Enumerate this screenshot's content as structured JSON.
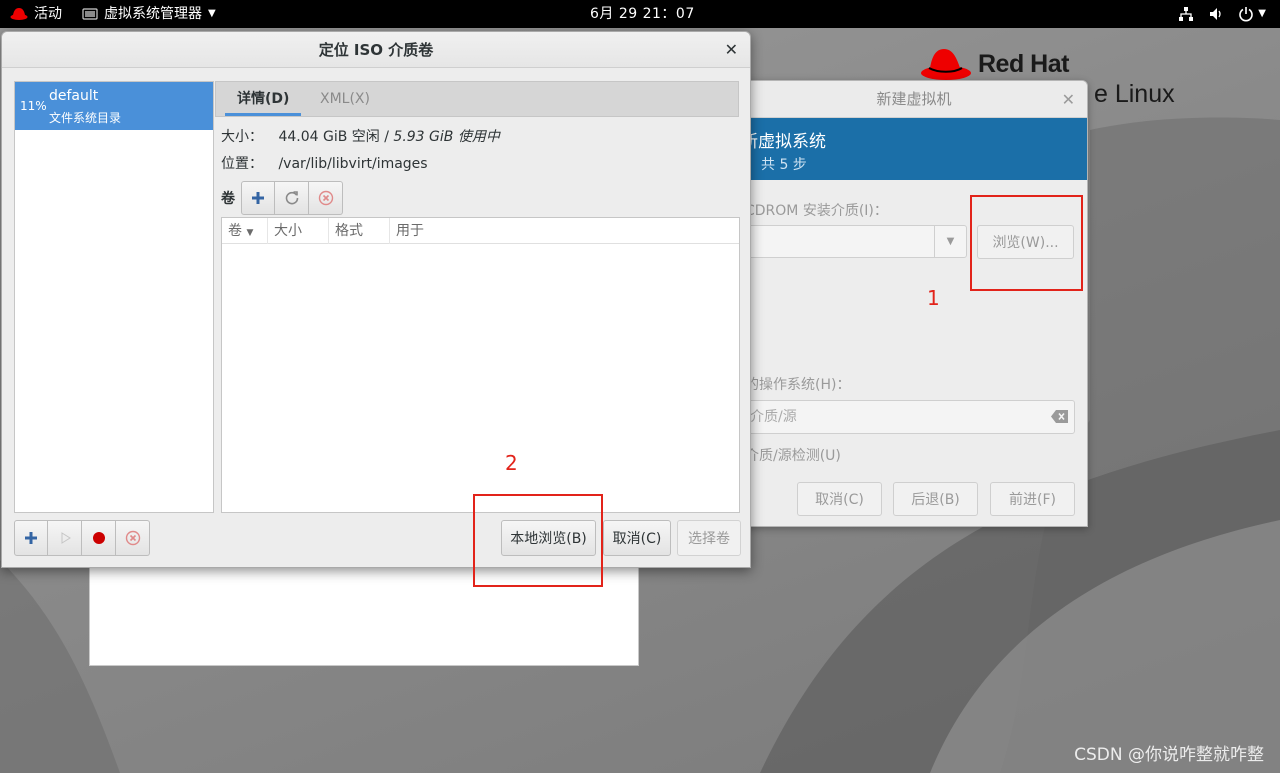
{
  "topbar": {
    "activities": "活动",
    "app_menu": "虚拟系统管理器",
    "clock": "6月 29  21：07",
    "tray_icons": [
      "network-icon",
      "volume-icon",
      "power-icon"
    ]
  },
  "desktop": {
    "brand_name": "Red Hat",
    "brand_sub": "e Linux",
    "watermark": "CSDN @你说咋整就咋整"
  },
  "new_vm_window": {
    "title": "新建虚拟机",
    "banner_title": "新虚拟系统",
    "banner_step": "共 5 步",
    "media_label": "CDROM 安装介质(I)：",
    "browse_button": "浏览(W)...",
    "os_label": "的操作系统(H)：",
    "os_placeholder": "介质/源",
    "autodetect_label": "介质/源检测(U)",
    "cancel_button": "取消(C)",
    "back_button": "后退(B)",
    "forward_button": "前进(F)"
  },
  "locate_iso_dialog": {
    "title": "定位 ISO 介质卷",
    "pools": [
      {
        "usage": "11%",
        "name": "default",
        "type": "文件系统目录"
      }
    ],
    "tabs": [
      {
        "label": "详情(D)",
        "active": true
      },
      {
        "label": "XML(X)",
        "active": false
      }
    ],
    "size_label": "大小：",
    "size_free": "44.04 GiB 空闲 /",
    "size_used": "5.93 GiB 使用中",
    "location_label": "位置：",
    "location_value": "/var/lib/libvirt/images",
    "volumes_label": "卷",
    "volume_columns": [
      "卷",
      "大小",
      "格式",
      "用于"
    ],
    "volumes": [],
    "local_browse_button": "本地浏览(B)",
    "cancel_button": "取消(C)",
    "select_volume_button": "选择卷"
  },
  "annotations": [
    {
      "number": "1"
    },
    {
      "number": "2"
    }
  ],
  "colors": {
    "accent_blue": "#4a90d9",
    "banner_blue": "#1b6fa8",
    "annotation_red": "#e2231a",
    "redhat_red": "#ee0000"
  }
}
